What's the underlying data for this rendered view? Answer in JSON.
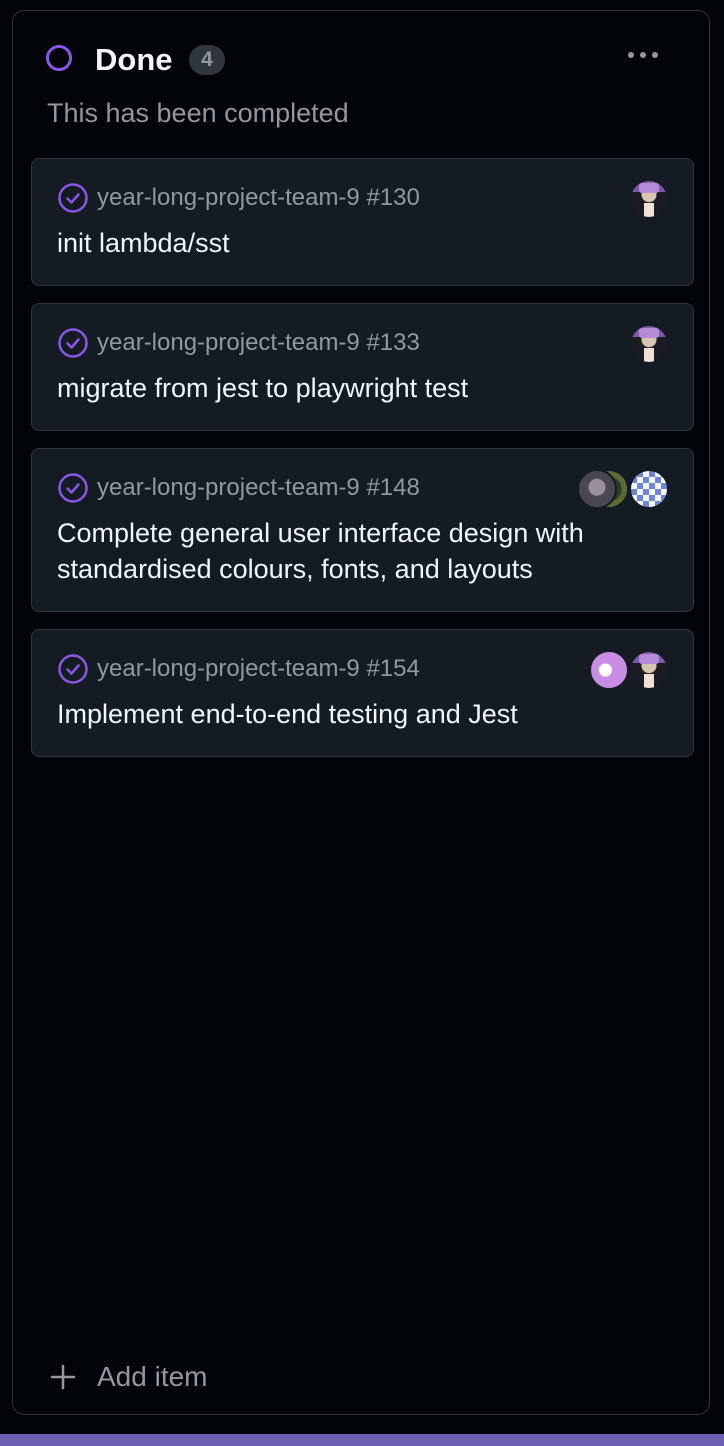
{
  "column": {
    "title": "Done",
    "count": "4",
    "description": "This has been completed",
    "status_color": "#8957e5",
    "add_item_label": "Add item"
  },
  "cards": [
    {
      "ref": "year-long-project-team-9 #130",
      "title": "init lambda/sst",
      "assignees": [
        "wizard-avatar"
      ]
    },
    {
      "ref": "year-long-project-team-9 #133",
      "title": "migrate from jest to playwright test",
      "assignees": [
        "wizard-avatar"
      ]
    },
    {
      "ref": "year-long-project-team-9 #148",
      "title": "Complete general user interface design with standardised colours, fonts, and layouts",
      "assignees": [
        "checker-avatar",
        "green-avatar",
        "gray-avatar"
      ]
    },
    {
      "ref": "year-long-project-team-9 #154",
      "title": "Implement end-to-end testing and Jest",
      "assignees": [
        "wizard-avatar",
        "pink-avatar"
      ]
    }
  ],
  "icons": {
    "status": "circle-icon",
    "done": "check-circle-icon",
    "more": "kebab-horizontal-icon",
    "add": "plus-icon"
  },
  "colors": {
    "background": "#010409",
    "card": "#151b23",
    "border": "#30363d",
    "done_purple": "#8957e5",
    "muted_text": "#9198a1"
  }
}
